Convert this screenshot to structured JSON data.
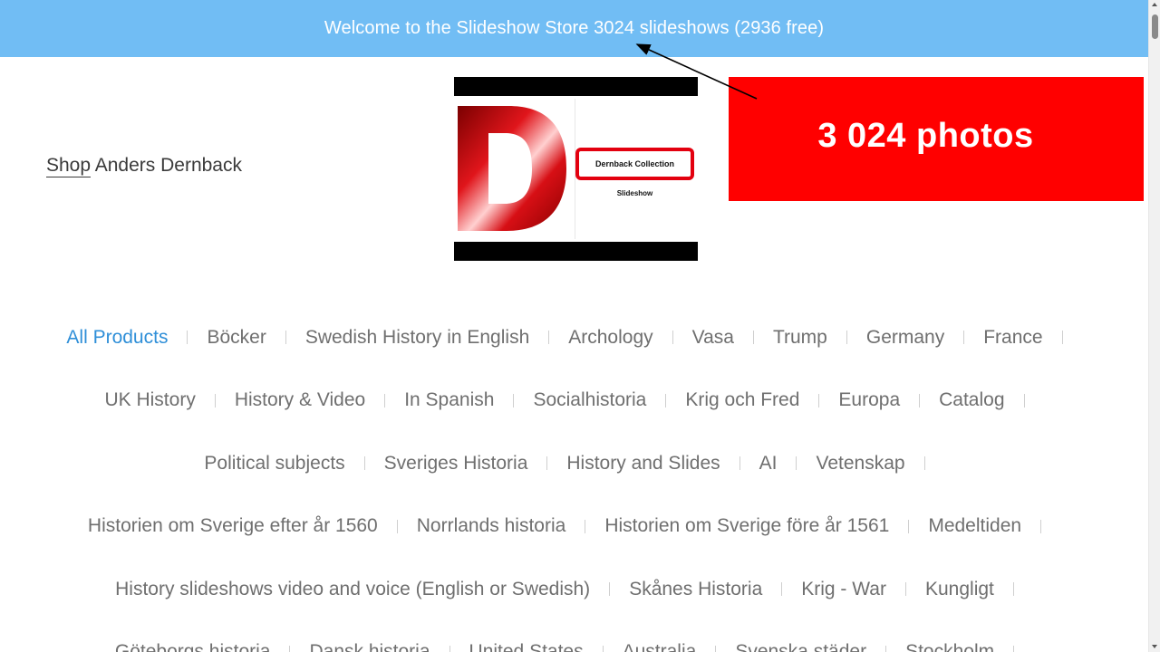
{
  "banner": {
    "text": "Welcome to the Slideshow Store 3024 slideshows (2936 free)"
  },
  "header": {
    "shop_label": "Shop",
    "owner_name": "Anders Dernback"
  },
  "logo": {
    "badge_text": "Dernback Collection",
    "sub_text": "Slideshow"
  },
  "callout": {
    "text": "3 024 photos"
  },
  "colors": {
    "banner_bg": "#71bdf4",
    "callout_bg": "#ff0000",
    "active_link": "#2f8fd8",
    "link": "#6f6f6f"
  },
  "categories": [
    [
      "All Products",
      "Böcker",
      "Swedish History in English",
      "Archology",
      "Vasa",
      "Trump",
      "Germany",
      "France"
    ],
    [
      "UK History",
      "History & Video",
      "In Spanish",
      "Socialhistoria",
      "Krig och Fred",
      "Europa",
      "Catalog"
    ],
    [
      "Political subjects",
      "Sveriges Historia",
      "History and Slides",
      "AI",
      "Vetenskap"
    ],
    [
      "Historien om Sverige efter år 1560",
      "Norrlands historia",
      "Historien om Sverige före år 1561",
      "Medeltiden"
    ],
    [
      "History slideshows video and voice (English or Swedish)",
      "Skånes Historia",
      "Krig - War",
      "Kungligt"
    ],
    [
      "Göteborgs historia",
      "Dansk historia",
      "United States",
      "Australia",
      "Svenska städer",
      "Stockholm"
    ]
  ],
  "active_category": "All Products"
}
